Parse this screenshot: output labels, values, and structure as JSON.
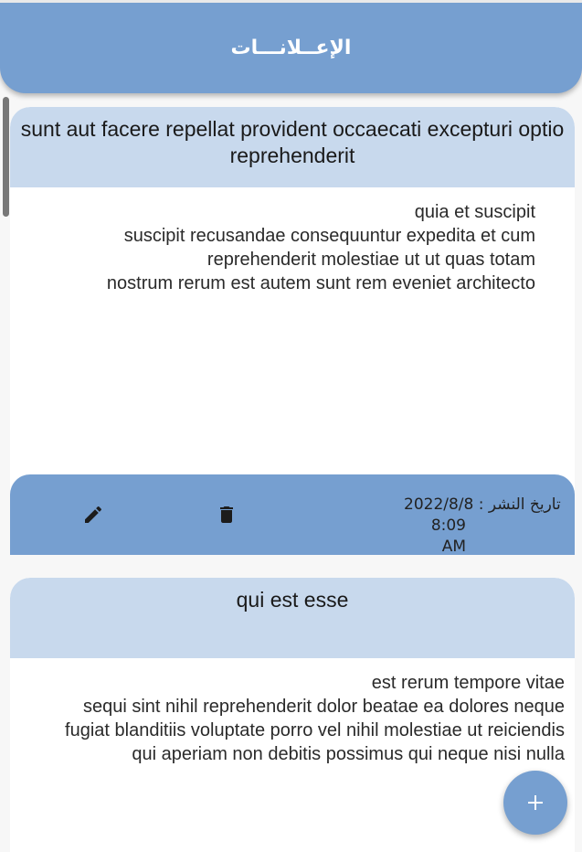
{
  "app_bar": {
    "title": "الإعــلانـــات"
  },
  "announcements": [
    {
      "title": "sunt aut facere repellat provident occaecati excepturi optio reprehenderit",
      "body": "quia et suscipit\nsuscipit recusandae consequuntur expedita et cum reprehenderit molestiae ut ut quas totam\nnostrum rerum est autem sunt rem eveniet architecto",
      "date_label": "تاريخ النشر : 2022/8/8",
      "time": "8:09 AM",
      "edit_icon": "pencil-icon",
      "delete_icon": "trash-icon"
    },
    {
      "title": "qui est esse",
      "body": "est rerum tempore vitae\nsequi sint nihil reprehenderit dolor beatae ea dolores neque\nfugiat blanditiis voluptate porro vel nihil molestiae ut reiciendis\nqui aperiam non debitis possimus qui neque nisi nulla"
    }
  ],
  "fab": {
    "icon": "plus-icon",
    "label": "+"
  },
  "colors": {
    "primary": "#769fd0",
    "header_light": "#c8d9ed",
    "background": "#f7f7f7"
  }
}
